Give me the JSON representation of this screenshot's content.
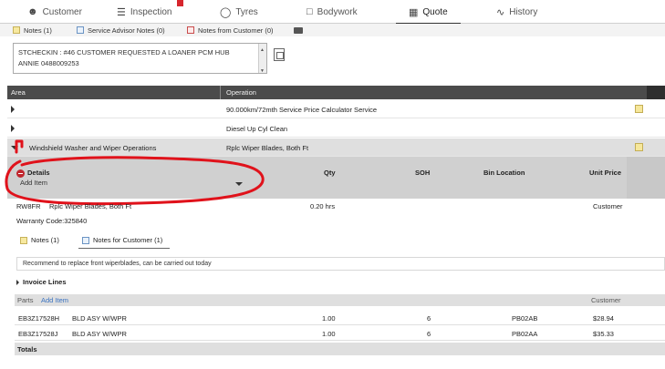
{
  "nav": {
    "tabs": [
      {
        "label": "Customer",
        "icon": "person-icon"
      },
      {
        "label": "Inspection",
        "icon": "list-icon"
      },
      {
        "label": "Tyres",
        "icon": "tyre-icon"
      },
      {
        "label": "Bodywork",
        "icon": "car-body-icon"
      },
      {
        "label": "Quote",
        "icon": "qr-icon"
      },
      {
        "label": "History",
        "icon": "chart-line-icon"
      }
    ],
    "active_tab": "Quote",
    "accent_color": "#d7262d"
  },
  "notes_tabs": [
    {
      "label": "Notes (1)"
    },
    {
      "label": "Service Advisor Notes (0)"
    },
    {
      "label": "Notes from Customer (0)"
    }
  ],
  "note_text": {
    "line1": "STCHECKIN : #46 CUSTOMER REQUESTED A LOANER PCM HUB",
    "line2": "ANNIE  0488009253"
  },
  "grid": {
    "headers": {
      "area": "Area",
      "operation": "Operation"
    },
    "rows": [
      {
        "area": "",
        "operation": "90.000km/72mth Service Price Calculator Service"
      },
      {
        "area": "",
        "operation": "Diesel Up Cyl Clean"
      },
      {
        "area": "Windshield Washer and Wiper Operations",
        "operation": "Rplc Wiper Blades, Both Ft"
      }
    ]
  },
  "details": {
    "title": "Details",
    "columns": {
      "qty": "Qty",
      "soh": "SOH",
      "bin": "Bin Location",
      "unit_price": "Unit Price"
    },
    "add_item_label": "Add Item",
    "line_code": "RW8FR",
    "line_desc": "Rplc Wiper Blades, Both Ft",
    "line_hours": "0.20 hrs",
    "line_payer": "Customer",
    "warranty": "Warranty Code:325840"
  },
  "sub_tabs": [
    {
      "label": "Notes (1)"
    },
    {
      "label": "Notes for Customer (1)"
    }
  ],
  "recommendation": "Recommend to replace front wiperblades, can be carried out today",
  "invoice_lines_label": "Invoice Lines",
  "parts": {
    "label": "Parts",
    "add_item_link": "Add Item",
    "payer_header": "Customer",
    "rows": [
      {
        "code": "EB3Z17528H",
        "desc": "BLD ASY W/WPR",
        "qty": "1.00",
        "soh": "6",
        "bin": "PB02AB",
        "price": "$28.94"
      },
      {
        "code": "EB3Z17528J",
        "desc": "BLD ASY W/WPR",
        "qty": "1.00",
        "soh": "6",
        "bin": "PB02AA",
        "price": "$35.33"
      }
    ]
  },
  "totals_label": "Totals"
}
